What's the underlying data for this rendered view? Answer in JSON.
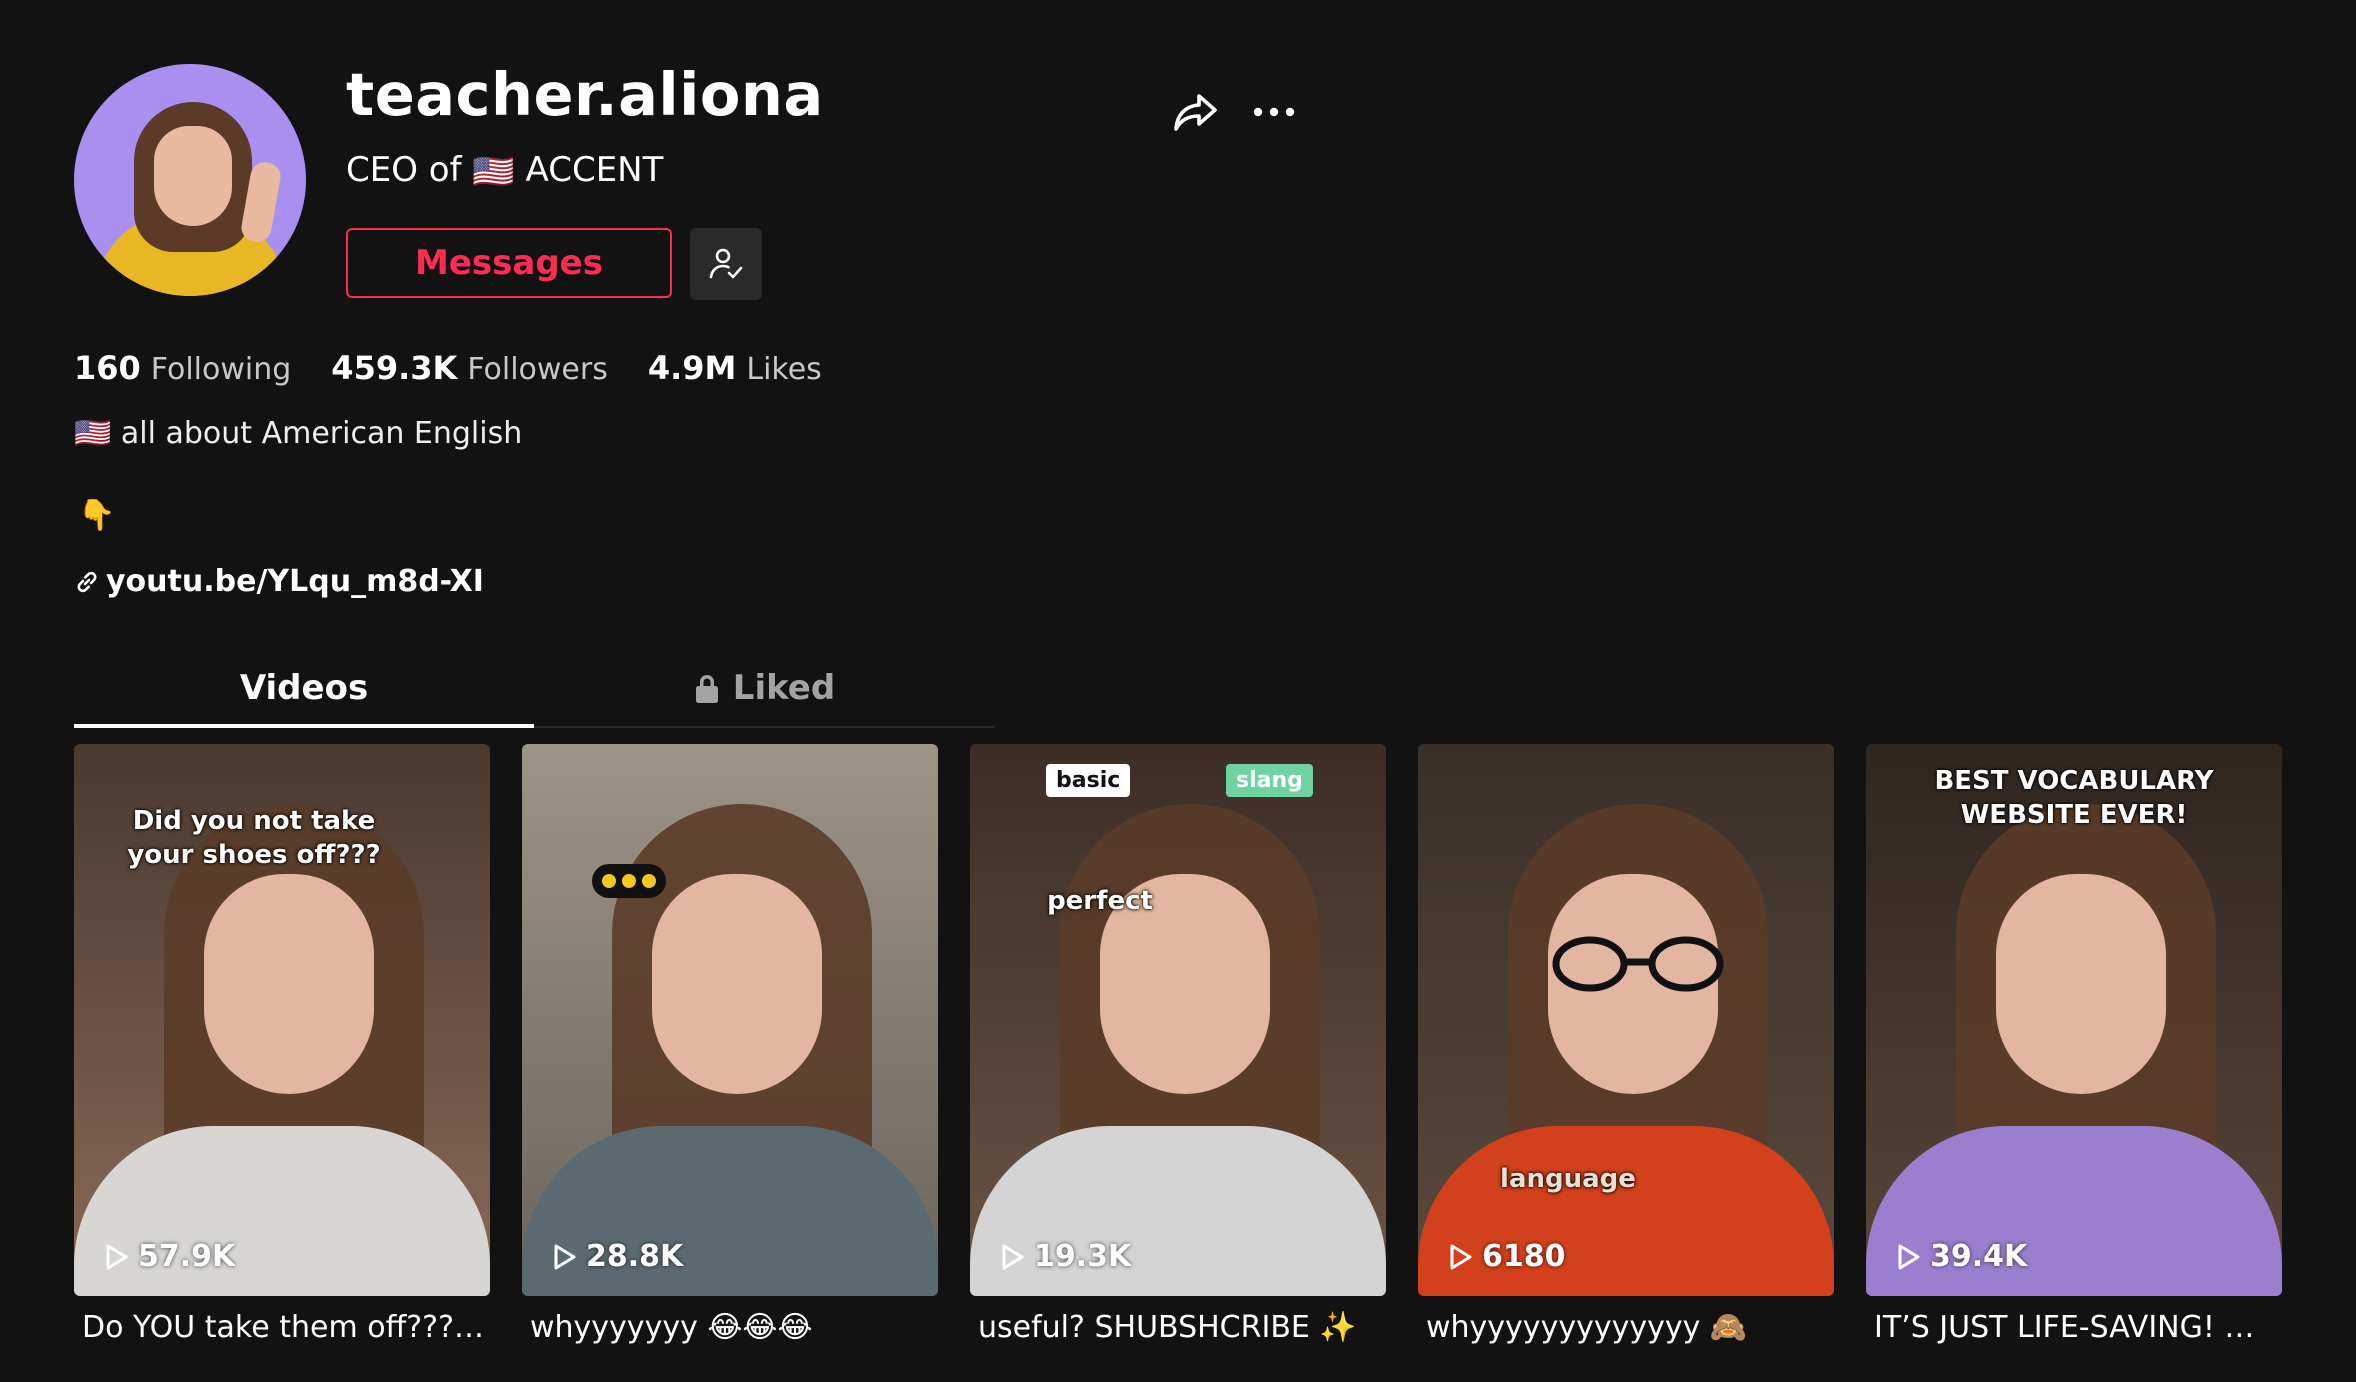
{
  "profile": {
    "username": "teacher.aliona",
    "title_prefix": "CEO of",
    "title_flag": "🇺🇸",
    "title_suffix": "ACCENT",
    "messages_label": "Messages"
  },
  "stats": [
    {
      "value": "160",
      "label": "Following"
    },
    {
      "value": "459.3K",
      "label": "Followers"
    },
    {
      "value": "4.9M",
      "label": "Likes"
    }
  ],
  "bio": {
    "flag": "🇺🇸",
    "line1": "all about American English",
    "pointer": "👇",
    "link": "youtu.be/YLqu_m8d-XI"
  },
  "tabs": {
    "videos": "Videos",
    "liked": "Liked"
  },
  "videos": [
    {
      "overlay": "Did you not take your shoes off???",
      "plays": "57.9K",
      "caption": "Do YOU take them off??????"
    },
    {
      "overlay": "",
      "plays": "28.8K",
      "caption": "whyyyyyyy 😂😂😂"
    },
    {
      "overlay": "perfect",
      "badge_left": "basic",
      "badge_right": "slang",
      "plays": "19.3K",
      "caption": "useful? SHUBSHCRIBE ✨"
    },
    {
      "overlay": "language",
      "plays": "6180",
      "caption": "whyyyyyyyyyyyyy 🙈"
    },
    {
      "overlay": "BEST VOCABULARY WEBSITE EVER!",
      "plays": "39.4K",
      "caption": "IT’S JUST LIFE-SAVING! 😁..."
    }
  ],
  "colors": {
    "background": "#121212",
    "accent": "#fe2c55",
    "muted": "#a3a3a3"
  },
  "icons": [
    "share-icon",
    "more-icon",
    "follow-check-icon",
    "link-icon",
    "lock-icon",
    "play-icon"
  ]
}
